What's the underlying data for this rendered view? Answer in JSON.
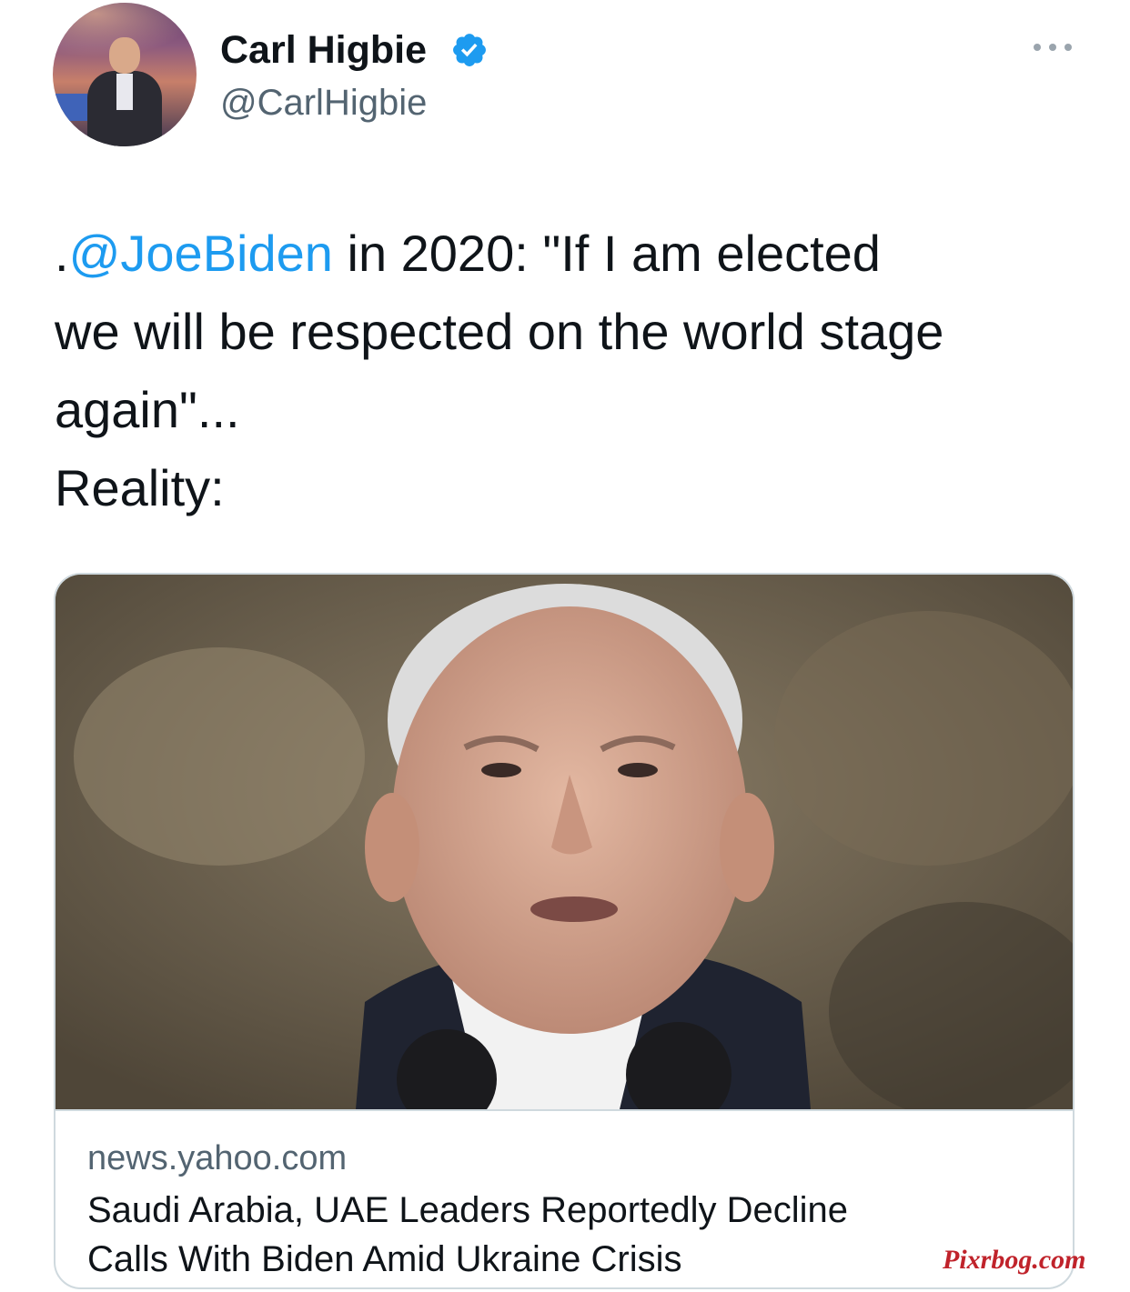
{
  "tweet": {
    "author": {
      "display_name": "Carl Higbie",
      "handle": "@CarlHigbie",
      "verified": true
    },
    "text": {
      "prefix": ".",
      "mention": "@JoeBiden",
      "body_line1": " in 2020: \"If I am elected",
      "body_line2": "we will be respected on the world stage",
      "body_line3": "again\"...",
      "body_line4": "Reality:"
    },
    "more_icon": "more-horizontal-icon"
  },
  "link_card": {
    "domain": "news.yahoo.com",
    "title_line1": "Saudi Arabia, UAE Leaders Reportedly Decline",
    "title_line2": "Calls With Biden Amid Ukraine Crisis"
  },
  "watermark": "Pixrbog.com",
  "colors": {
    "mention": "#1d9bf0",
    "verified": "#1d9bf0",
    "secondary_text": "#536471",
    "card_border": "#cfd9de",
    "watermark": "#c0232b"
  }
}
